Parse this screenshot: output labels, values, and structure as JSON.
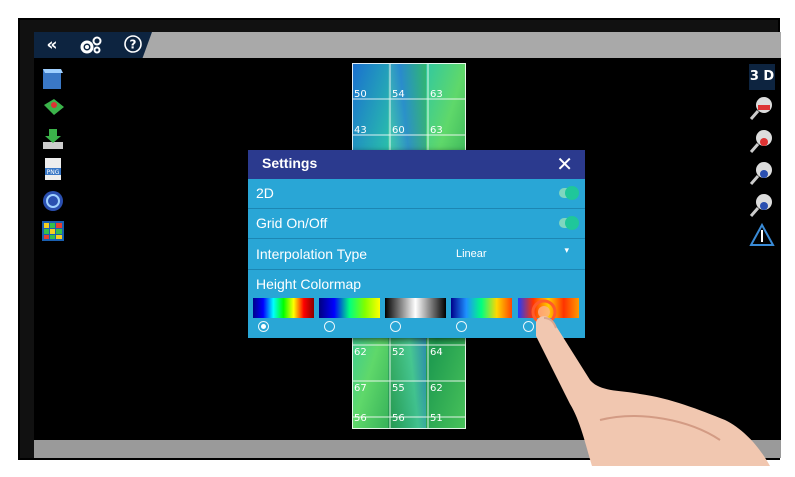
{
  "toolbar": {
    "collapse_icon": "«",
    "settings_icon": "gear-icon",
    "help_icon": "?"
  },
  "right_toolbar": {
    "view_3d_label": "3 D"
  },
  "grid": {
    "top_rows": [
      [
        "50",
        "54",
        "63"
      ],
      [
        "43",
        "60",
        "63"
      ]
    ],
    "bottom_rows": [
      [
        "62",
        "52",
        "64"
      ],
      [
        "67",
        "55",
        "62"
      ],
      [
        "56",
        "56",
        "51"
      ]
    ]
  },
  "settings": {
    "title": "Settings",
    "close": "✕",
    "rows": {
      "mode_2d": {
        "label": "2D",
        "on": true
      },
      "grid": {
        "label": "Grid On/Off",
        "on": true
      },
      "interpolation": {
        "label": "Interpolation Type",
        "value": "Linear"
      },
      "colormap": {
        "label": "Height Colormap",
        "selected_index": 0
      }
    }
  },
  "colors": {
    "dialog_header": "#2b3a8e",
    "dialog_body": "#29a6d6",
    "toggle_on": "#1fc79a"
  }
}
